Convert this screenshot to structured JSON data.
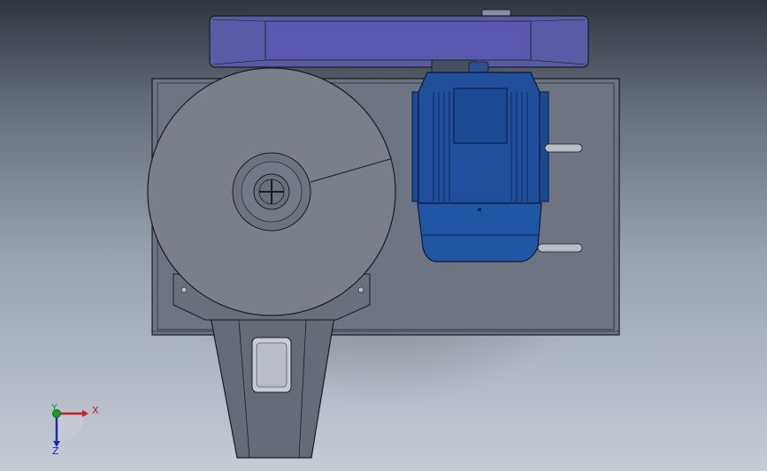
{
  "viewport": {
    "background_top": "#2f3640",
    "background_bottom": "#c6ccd6"
  },
  "model": {
    "colors": {
      "plate": "#6e7482",
      "disc": "#7a7f8a",
      "belt_guard": "#5a5aa6",
      "motor": "#1f4f9a",
      "motor_dark": "#0f3a78",
      "edge": "#1a1c22",
      "slot": "#b9bdc6"
    }
  },
  "triad": {
    "x_label": "X",
    "y_label": "Y",
    "z_label": "Z",
    "x_color": "#c0202a",
    "y_color": "#1a9a2a",
    "z_color": "#1a2aa8"
  }
}
